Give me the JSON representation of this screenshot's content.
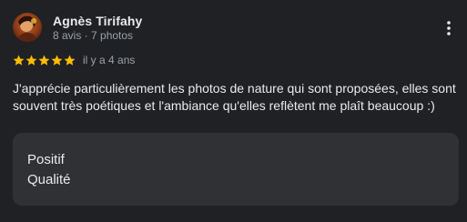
{
  "review": {
    "author": {
      "name": "Agnès Tirifahy",
      "meta": "8 avis · 7 photos",
      "avatar_icon": "user-avatar-photo"
    },
    "rating": {
      "value": 5,
      "max": 5,
      "star_color": "#fbbc04",
      "time_ago": "il y a 4 ans"
    },
    "text": "J'apprécie particulièrement les photos de nature qui sont proposées, elles sont souvent très poétiques et l'ambiance qu'elles reflètent me plaît beaucoup :)",
    "attributes": [
      "Positif",
      "Qualité"
    ],
    "menu_icon": "more-vert-icon"
  }
}
